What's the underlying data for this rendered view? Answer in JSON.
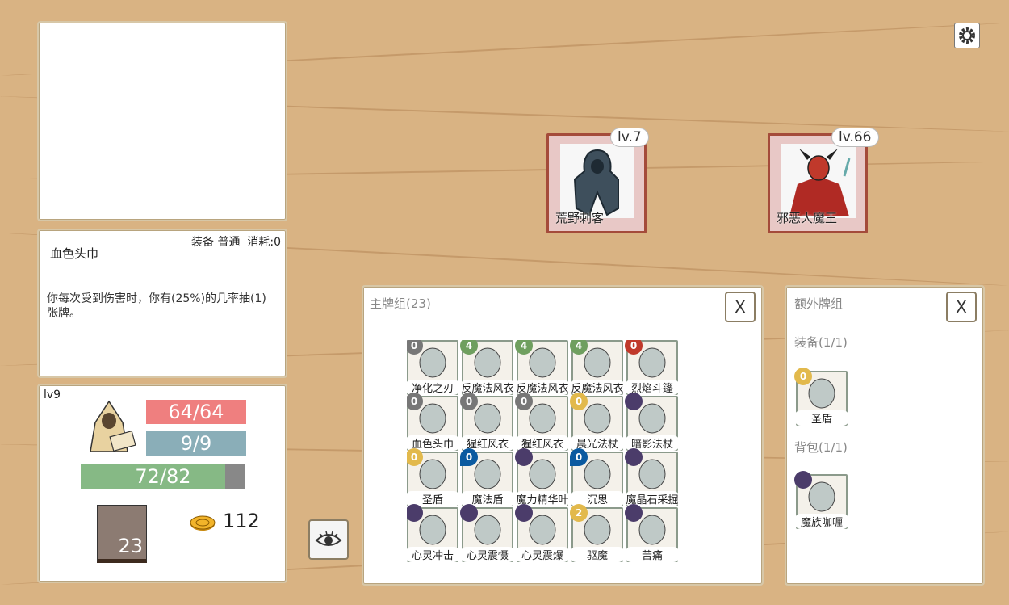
{
  "settings_icon": "gear-icon",
  "colors": {
    "hp": "#ef7f7f",
    "mana": "#8aaeb8",
    "xp": "#86b985",
    "xp_empty": "#888888",
    "accent_card_border": "#a44b3a"
  },
  "enemies": [
    {
      "level": "lv.7",
      "name": "荒野刺客",
      "icon": "hooded-assassin-icon"
    },
    {
      "level": "lv.66",
      "name": "邪恶大魔王",
      "icon": "demon-lord-icon"
    }
  ],
  "card_detail": {
    "title": "血色头巾",
    "meta": "装备 普通  消耗:0",
    "description": "你每次受到伤害时，你有(25%)的几率抽(1)张牌。"
  },
  "player": {
    "level": "lv9",
    "hp": "64/64",
    "mana": "9/9",
    "xp": "72/82",
    "xp_fraction": 0.878,
    "deck_count": "23",
    "gold": "112",
    "avatar_icon": "hooded-scholar-icon",
    "coin_icon": "gold-coin-icon"
  },
  "view_button_icon": "eye-icon",
  "main_deck": {
    "title": "主牌组(23)",
    "close_label": "X",
    "rows": [
      [
        {
          "name": "净化之刃",
          "cost": "0",
          "cost_type": "gear",
          "icon": "dagger-icon"
        },
        {
          "name": "反魔法风衣",
          "cost": "4",
          "cost_type": "green",
          "icon": "cloak-icon"
        },
        {
          "name": "反魔法风衣",
          "cost": "4",
          "cost_type": "green",
          "icon": "cloak-icon"
        },
        {
          "name": "反魔法风衣",
          "cost": "4",
          "cost_type": "green",
          "icon": "cloak-icon"
        },
        {
          "name": "烈焰斗篷",
          "cost": "0",
          "cost_type": "red",
          "icon": "flame-cape-icon"
        }
      ],
      [
        {
          "name": "血色头巾",
          "cost": "0",
          "cost_type": "gear",
          "icon": "red-hood-icon"
        },
        {
          "name": "猩红风衣",
          "cost": "0",
          "cost_type": "gear",
          "icon": "red-cloak-icon"
        },
        {
          "name": "猩红风衣",
          "cost": "0",
          "cost_type": "gear",
          "icon": "red-cloak-icon"
        },
        {
          "name": "晨光法杖",
          "cost": "0",
          "cost_type": "yellow",
          "icon": "sun-staff-icon"
        },
        {
          "name": "暗影法杖",
          "cost": "",
          "cost_type": "purple",
          "icon": "shadow-staff-icon"
        }
      ],
      [
        {
          "name": "圣盾",
          "cost": "0",
          "cost_type": "yellow",
          "icon": "shield-icon"
        },
        {
          "name": "魔法盾",
          "cost": "0",
          "cost_type": "blue",
          "icon": "magic-shield-icon"
        },
        {
          "name": "魔力精华叶",
          "cost": "",
          "cost_type": "purple",
          "icon": "leaf-icon"
        },
        {
          "name": "沉思",
          "cost": "0",
          "cost_type": "blue",
          "icon": "meditate-icon"
        },
        {
          "name": "魔晶石采掘",
          "cost": "",
          "cost_type": "purple",
          "icon": "crystal-icon"
        }
      ],
      [
        {
          "name": "心灵冲击",
          "cost": "",
          "cost_type": "purple",
          "icon": "mind-blast-icon"
        },
        {
          "name": "心灵震慑",
          "cost": "",
          "cost_type": "purple",
          "icon": "mind-shock-icon"
        },
        {
          "name": "心灵震爆",
          "cost": "",
          "cost_type": "purple",
          "icon": "mind-burst-icon"
        },
        {
          "name": "驱魔",
          "cost": "2",
          "cost_type": "yellow",
          "icon": "exorcise-icon"
        },
        {
          "name": "苦痛",
          "cost": "",
          "cost_type": "purple",
          "icon": "agony-icon"
        }
      ]
    ]
  },
  "extra_deck": {
    "title": "额外牌组",
    "close_label": "X",
    "equipment_title": "装备(1/1)",
    "equipment": [
      {
        "name": "圣盾",
        "cost": "0",
        "cost_type": "yellow",
        "icon": "shield-icon"
      }
    ],
    "backpack_title": "背包(1/1)",
    "backpack": [
      {
        "name": "魔族咖喱",
        "cost": "",
        "cost_type": "purple",
        "icon": "curry-icon"
      }
    ]
  }
}
